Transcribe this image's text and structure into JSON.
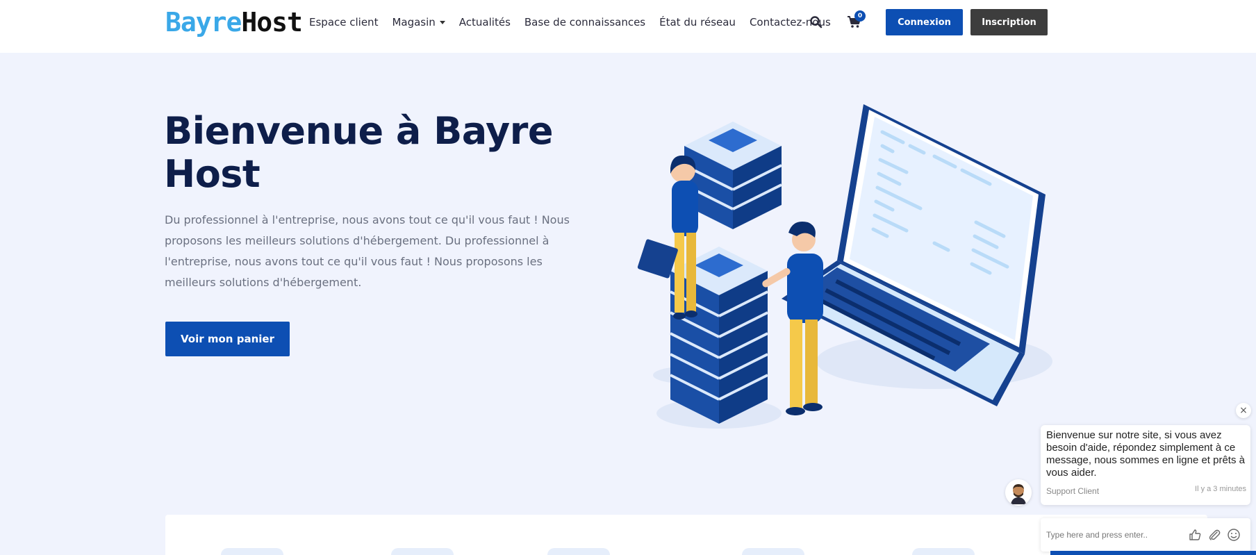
{
  "header": {
    "logo_part1": "Bayre",
    "logo_part2": "Host",
    "nav": [
      "Espace client",
      "Magasin",
      "Actualités",
      "Base de connaissances",
      "État du réseau",
      "Contactez-nous"
    ],
    "cart_count": "0",
    "login_label": "Connexion",
    "register_label": "Inscription",
    "icons": [
      "search-icon",
      "cart-icon",
      "caret-down-icon"
    ]
  },
  "hero": {
    "title": "Bienvenue à Bayre Host",
    "text": "Du professionnel à l'entreprise, nous avons tout ce qu'il vous faut ! Nous proposons les meilleurs solutions d'hébergement. Du professionnel à l'entreprise, nous avons tout ce qu'il vous faut ! Nous proposons les meilleurs solutions d'hébergement.",
    "cta_label": "Voir mon panier"
  },
  "chat": {
    "close_glyph": "×",
    "message": "Bienvenue sur notre site, si vous avez besoin d'aide, répondez simplement à ce message, nous sommes en ligne et prêts à vous aider.",
    "sender": "Support Client",
    "time": "Il y a 3 minutes",
    "input_placeholder": "Type here and press enter..",
    "icons": [
      "thumbs-up-icon",
      "paperclip-icon",
      "emoji-icon"
    ]
  },
  "colors": {
    "primary": "#0d4fb3",
    "dark_button": "#3d3d3d",
    "hero_bg": "#f0f3fd",
    "title": "#0e1e4a",
    "logo_blue": "#3aa8e8"
  }
}
